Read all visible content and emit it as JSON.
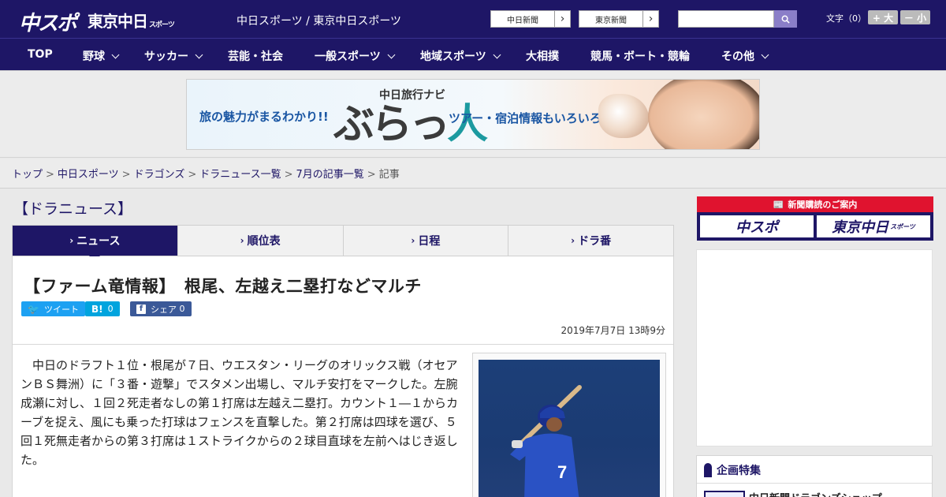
{
  "header": {
    "logo_chuspo": "中スポ",
    "logo_tokyo": "東京中日",
    "logo_tokyo_small": "スポーツ",
    "site_name": "中日スポーツ / 東京中日スポーツ",
    "link_chunichi": "中日新聞",
    "link_tokyo": "東京新聞",
    "search_placeholder": "",
    "fontsize_label": "文字（0）",
    "fontsize_up": "+ 大",
    "fontsize_down": "－ 小"
  },
  "nav": {
    "items": [
      {
        "label": "TOP",
        "dropdown": false
      },
      {
        "label": "野球",
        "dropdown": true
      },
      {
        "label": "サッカー",
        "dropdown": true
      },
      {
        "label": "芸能・社会",
        "dropdown": false
      },
      {
        "label": "一般スポーツ",
        "dropdown": true
      },
      {
        "label": "地域スポーツ",
        "dropdown": true
      },
      {
        "label": "大相撲",
        "dropdown": false
      },
      {
        "label": "競馬・ボート・競輪",
        "dropdown": false
      },
      {
        "label": "その他",
        "dropdown": true
      }
    ]
  },
  "ad": {
    "tag": "中日旅行ナビ",
    "left": "旅の魅力がまるわかり!!",
    "brand_main": "ぶらっ",
    "brand_accent": "人",
    "right": "ツアー・宿泊情報もいろいろ"
  },
  "breadcrumb": {
    "items": [
      "トップ",
      "中日スポーツ",
      "ドラゴンズ",
      "ドラニュース一覧",
      "7月の記事一覧"
    ],
    "current": "記事",
    "separator": ">"
  },
  "main": {
    "section_title": "【ドラニュース】",
    "tabs": [
      {
        "label": "ニュース",
        "active": true
      },
      {
        "label": "順位表",
        "active": false
      },
      {
        "label": "日程",
        "active": false
      },
      {
        "label": "ドラ番",
        "active": false
      }
    ],
    "headline": "【ファーム竜情報】　根尾、左越え二塁打などマルチ",
    "share": {
      "tweet": "ツイート",
      "hatena_icon": "B!",
      "hatena_count": "0",
      "facebook": "シェア",
      "facebook_count": "0"
    },
    "date": "2019年7月7日 13時9分",
    "body": "中日のドラフト１位・根尾が７日、ウエスタン・リーグのオリックス戦（オセアンＢＳ舞洲）に「３番・遊撃」でスタメン出場し、マルチ安打をマークした。左腕成瀬に対し、１回２死走者なしの第１打席は左越え二塁打。カウント１―１からカーブを捉え、風にも乗った打球はフェンスを直撃した。第２打席は四球を選び、５回１死無走者からの第３打席は１ストライクからの２球目直球を左前へはじき返した。"
  },
  "sidebar": {
    "subscription_title": "新聞購読のご案内",
    "sub_chuspo": "中スポ",
    "sub_tokyo": "東京中日",
    "sub_tokyo_small": "スポーツ",
    "feature_title": "企画特集",
    "feature_item": "中日新聞ドラゴンズショップ"
  },
  "colors": {
    "brand_navy": "#1e1666",
    "accent_red": "#e0132f",
    "twitter": "#1da1f2",
    "hatena": "#00a4de",
    "facebook": "#3b5998"
  }
}
